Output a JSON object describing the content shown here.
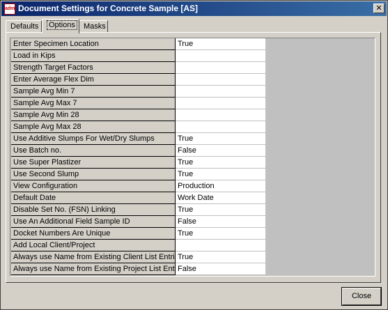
{
  "window": {
    "title": "Document Settings for Concrete Sample [AS]",
    "icon_text": "adm",
    "close_glyph": "✕"
  },
  "tabs": [
    {
      "label": "Defaults"
    },
    {
      "label": "Options"
    },
    {
      "label": "Masks"
    }
  ],
  "active_tab": "Options",
  "settings": [
    {
      "label": "Enter Specimen Location",
      "value": "True"
    },
    {
      "label": "Load in Kips",
      "value": ""
    },
    {
      "label": "Strength Target Factors",
      "value": ""
    },
    {
      "label": "Enter Average Flex Dim",
      "value": ""
    },
    {
      "label": "Sample Avg Min 7",
      "value": ""
    },
    {
      "label": "Sample Avg Max 7",
      "value": ""
    },
    {
      "label": "Sample Avg Min 28",
      "value": ""
    },
    {
      "label": "Sample Avg Max 28",
      "value": ""
    },
    {
      "label": "Use Additive Slumps For Wet/Dry Slumps",
      "value": "True"
    },
    {
      "label": "Use Batch no.",
      "value": "False"
    },
    {
      "label": "Use Super Plastizer",
      "value": "True"
    },
    {
      "label": "Use Second Slump",
      "value": "True"
    },
    {
      "label": "View Configuration",
      "value": "Production"
    },
    {
      "label": "Default Date",
      "value": "Work Date"
    },
    {
      "label": "Disable Set No. (FSN) Linking",
      "value": "True"
    },
    {
      "label": "Use An Additional Field Sample ID",
      "value": "False"
    },
    {
      "label": "Docket Numbers Are Unique",
      "value": "True"
    },
    {
      "label": "Add Local Client/Project",
      "value": ""
    },
    {
      "label": "Always use Name from Existing Client List Entri",
      "value": "True"
    },
    {
      "label": "Always use Name from Existing Project List Ent",
      "value": "False"
    }
  ],
  "buttons": {
    "close_label": "Close"
  }
}
